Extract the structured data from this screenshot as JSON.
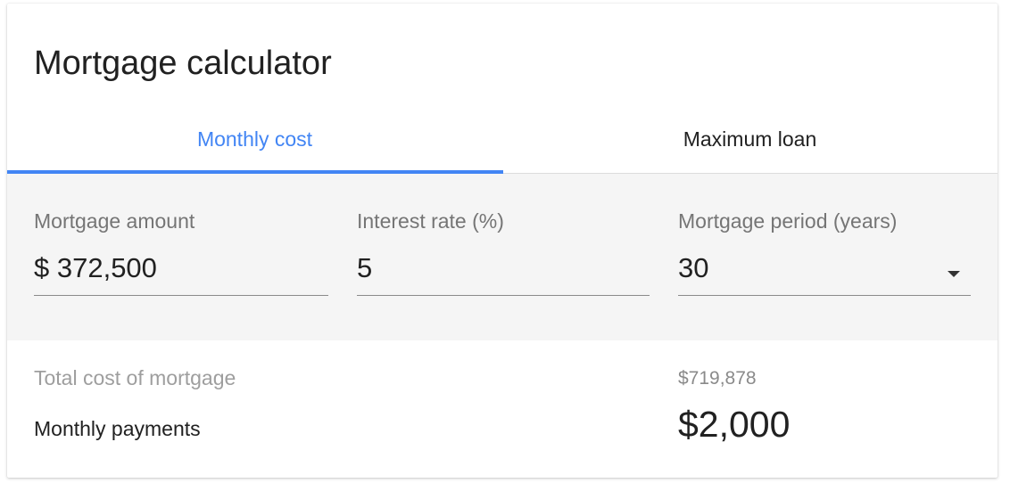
{
  "widget": {
    "title": "Mortgage calculator"
  },
  "tabs": [
    {
      "label": "Monthly cost",
      "active": true
    },
    {
      "label": "Maximum loan",
      "active": false
    }
  ],
  "inputs": {
    "amount": {
      "label": "Mortgage amount",
      "value": "$ 372,500"
    },
    "rate": {
      "label": "Interest rate (%)",
      "value": "5"
    },
    "period": {
      "label": "Mortgage period (years)",
      "value": "30",
      "icon": "dropdown-arrow-icon"
    }
  },
  "results": {
    "total_label": "Total cost of mortgage",
    "total_value": "$719,878",
    "monthly_label": "Monthly payments",
    "monthly_value": "$2,000"
  },
  "colors": {
    "accent": "#4285f4",
    "panel_background": "#f5f5f5",
    "text_primary": "#212121",
    "text_secondary": "#757575"
  }
}
